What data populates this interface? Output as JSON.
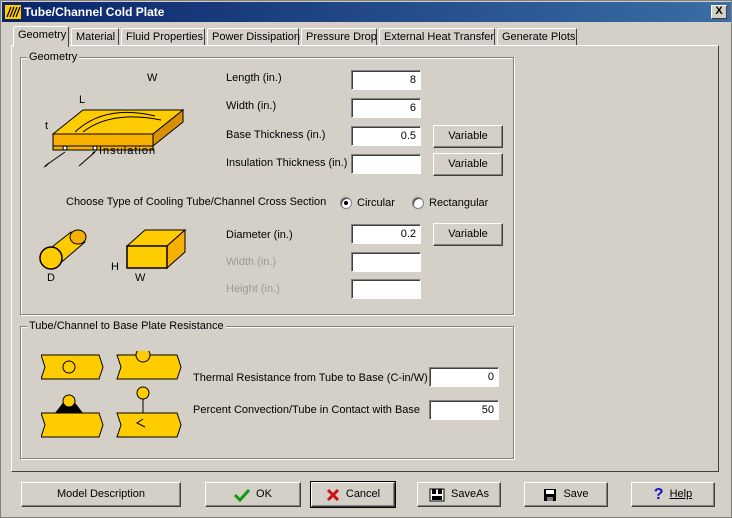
{
  "window": {
    "title": "Tube/Channel Cold Plate",
    "close_label": "X"
  },
  "tabs": [
    {
      "label": "Geometry"
    },
    {
      "label": "Material"
    },
    {
      "label": "Fluid Properties"
    },
    {
      "label": "Power Dissipation"
    },
    {
      "label": "Pressure Drop"
    },
    {
      "label": "External Heat Transfer"
    },
    {
      "label": "Generate Plots"
    }
  ],
  "geometry_group": {
    "title": "Geometry",
    "plate_diagram": {
      "w": "W",
      "l": "L",
      "t": "t",
      "insulation": "Insulation"
    },
    "length": {
      "label": "Length (in.)",
      "value": "8"
    },
    "width": {
      "label": "Width (in.)",
      "value": "6"
    },
    "base_thickness": {
      "label": "Base Thickness (in.)",
      "value": "0.5",
      "button": "Variable"
    },
    "insulation_thickness": {
      "label": "Insulation Thickness (in.)",
      "value": "",
      "button": "Variable"
    },
    "cross_section": {
      "prompt": "Choose Type of Cooling Tube/Channel Cross Section",
      "options": [
        {
          "label": "Circular",
          "selected": true
        },
        {
          "label": "Rectangular",
          "selected": false
        }
      ]
    },
    "tube_diagram": {
      "d": "D",
      "h": "H",
      "w": "W"
    },
    "diameter": {
      "label": "Diameter (in.)",
      "value": "0.2",
      "button": "Variable"
    },
    "channel_width": {
      "label": "Width (in.)",
      "value": ""
    },
    "channel_height": {
      "label": "Height (in.)",
      "value": ""
    }
  },
  "resistance_group": {
    "title": "Tube/Channel to Base Plate Resistance",
    "thermal_resistance": {
      "label": "Thermal Resistance from Tube to Base (C-in/W)",
      "value": "0"
    },
    "percent_convection": {
      "label": "Percent Convection/Tube in Contact with Base",
      "value": "50"
    }
  },
  "footer": {
    "model_description": "Model Description",
    "ok": "OK",
    "cancel": "Cancel",
    "save_as": "SaveAs",
    "save": "Save",
    "help": "Help"
  },
  "colors": {
    "accent_yellow": "#ffcc00",
    "plate_orange": "#f8b000",
    "title_blue": "#0a246a"
  }
}
